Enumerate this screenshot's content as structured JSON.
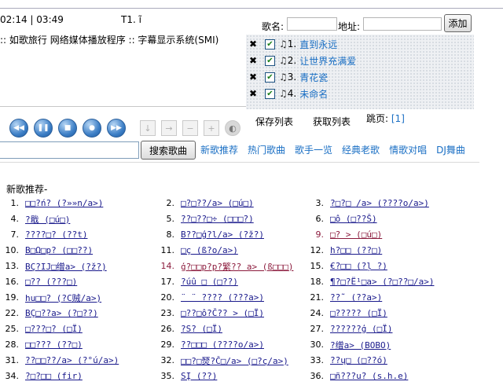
{
  "player": {
    "time_current": "02:14",
    "time_sep": "|",
    "time_total": "03:49",
    "track_label": "T1. ĩ",
    "marquee": ":: 如歌旅行 网络媒体播放程序 :: 字幕显示系统(SMI)"
  },
  "controls": [
    {
      "name": "rewind-icon",
      "glyph": "◀◀"
    },
    {
      "name": "pause-icon",
      "glyph": "❚❚"
    },
    {
      "name": "stop-icon",
      "glyph": "■"
    },
    {
      "name": "play-icon",
      "glyph": "●"
    },
    {
      "name": "fast-forward-icon",
      "glyph": "▶▶"
    }
  ],
  "tools": [
    {
      "name": "download-icon",
      "glyph": "↓"
    },
    {
      "name": "next-icon",
      "glyph": "→"
    },
    {
      "name": "minus-icon",
      "glyph": "−"
    },
    {
      "name": "plus-icon",
      "glyph": "+"
    },
    {
      "name": "volume-icon",
      "glyph": "◐"
    }
  ],
  "playlist": {
    "name_label": "歌名:",
    "url_label": "地址:",
    "name_value": "",
    "url_value": "",
    "add_button": "添加",
    "items": [
      {
        "num": "1.",
        "title": "直到永远"
      },
      {
        "num": "2.",
        "title": "让世界充满爱"
      },
      {
        "num": "3.",
        "title": "青花瓷"
      },
      {
        "num": "4.",
        "title": "未命名"
      }
    ],
    "save_button": "保存列表",
    "fetch_button": "获取列表",
    "jump_label": "跳页:",
    "jump_page": "[1]"
  },
  "search": {
    "input_value": "",
    "button": "搜索歌曲"
  },
  "nav": [
    "新歌推荐",
    "热门歌曲",
    "歌手一览",
    "经典老歌",
    "情歌对唱",
    "DJ舞曲"
  ],
  "section_title": "新歌推荐-",
  "songs": [
    {
      "num": "1.",
      "title": "□□?ń? (?»»n/a>)"
    },
    {
      "num": "2.",
      "title": "□?□??/a> (□ú□)"
    },
    {
      "num": "3.",
      "title": "?□?□ /a> (????o/a>)"
    },
    {
      "num": "4.",
      "title": "?戢 (□ú□)"
    },
    {
      "num": "5.",
      "title": "??□??□÷ (□□□?)"
    },
    {
      "num": "6.",
      "title": "□ô (□??Š)"
    },
    {
      "num": "7.",
      "title": "????□? (??t)"
    },
    {
      "num": "8.",
      "title": "B??□ģ?l/a> (?ž?)"
    },
    {
      "num": "9.",
      "title": "□? > (□ú□)"
    },
    {
      "num": "10.",
      "title": "B□Ω□p? (□□??)"
    },
    {
      "num": "11.",
      "title": "□ç (ß?o/a>)"
    },
    {
      "num": "12.",
      "title": "h?□□ (??□)"
    },
    {
      "num": "13.",
      "title": "BÇ?IJ□缯a> (?ž?)"
    },
    {
      "num": "14.",
      "title": "ģ?□□p?p?繁?? a> (ß□□□)"
    },
    {
      "num": "15.",
      "title": "€?□□ (?ļ ?)"
    },
    {
      "num": "16.",
      "title": "□?? (???□)"
    },
    {
      "num": "17.",
      "title": "?úû □ (□??)"
    },
    {
      "num": "18.",
      "title": "¶?□?Ë¹□a> (?□??□/a>)"
    },
    {
      "num": "19.",
      "title": "hu□□? (?C贼/a>)"
    },
    {
      "num": "20.",
      "title": "¨ ¨ ???? (???a>)"
    },
    {
      "num": "21.",
      "title": "??˜ (??a>)"
    },
    {
      "num": "22.",
      "title": "BÇ□??a> (?□??)"
    },
    {
      "num": "23.",
      "title": "□??□ô?Č?? > (□Ï)"
    },
    {
      "num": "24.",
      "title": "□????? (□Ï)"
    },
    {
      "num": "25.",
      "title": "□???□? (□Ï)"
    },
    {
      "num": "26.",
      "title": "?S? (□Ï)"
    },
    {
      "num": "27.",
      "title": "??????ģ (□Ï)"
    },
    {
      "num": "28.",
      "title": "□□??? (??□)"
    },
    {
      "num": "29.",
      "title": "??□□□ (????o/a>)"
    },
    {
      "num": "30.",
      "title": "?缯a> (BOBO)"
    },
    {
      "num": "31.",
      "title": "??□□??/a> (?°ú/a>)"
    },
    {
      "num": "32.",
      "title": "□□?□燹?Č□/a> (□?ç/a>)"
    },
    {
      "num": "33.",
      "title": "??ų□ (□??ó)"
    },
    {
      "num": "34.",
      "title": "?□?□□ (fir)"
    },
    {
      "num": "35.",
      "title": "SĮ (??)"
    },
    {
      "num": "36.",
      "title": "□ñ???u? (s.h.e)"
    }
  ],
  "colors": {
    "link": "#1a6fc4",
    "song_link": "#1a1a8c",
    "visited": "#8b1a3c",
    "button_blue": "#3d7fc6"
  }
}
